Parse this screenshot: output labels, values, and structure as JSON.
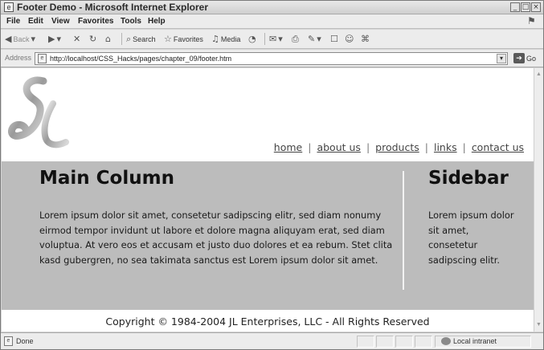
{
  "window": {
    "title": "Footer Demo - Microsoft Internet Explorer",
    "app_icon": "ie-page-icon",
    "controls": [
      "_",
      "□",
      "×"
    ]
  },
  "menubar": {
    "items": [
      "File",
      "Edit",
      "View",
      "Favorites",
      "Tools",
      "Help"
    ]
  },
  "toolbar": {
    "back_label": "Back",
    "search_label": "Search",
    "favorites_label": "Favorites",
    "media_label": "Media"
  },
  "addressbar": {
    "label": "Address",
    "url": "http://localhost/CSS_Hacks/pages/chapter_09/footer.htm",
    "go_label": "Go"
  },
  "page": {
    "logo_text": "JL",
    "nav": [
      "home",
      "about us",
      "products",
      "links",
      "contact us"
    ],
    "nav_separator": "|",
    "main_title": "Main Column",
    "main_text": "Lorem ipsum dolor sit amet, consetetur sadipscing elitr, sed diam nonumy eirmod tempor invidunt ut labore et dolore magna aliquyam erat, sed diam voluptua. At vero eos et accusam et justo duo dolores et ea rebum. Stet clita kasd gubergren, no sea takimata sanctus est Lorem ipsum dolor sit amet.",
    "sidebar_title": "Sidebar",
    "sidebar_text": "Lorem ipsum dolor sit amet, consetetur sadipscing elitr.",
    "copyright": "Copyright © 1984-2004 JL Enterprises, LLC - All Rights Reserved"
  },
  "statusbar": {
    "status": "Done",
    "zone": "Local intranet"
  },
  "colors": {
    "content_bg": "#bcbcbc",
    "chrome_bg": "#ececec"
  }
}
